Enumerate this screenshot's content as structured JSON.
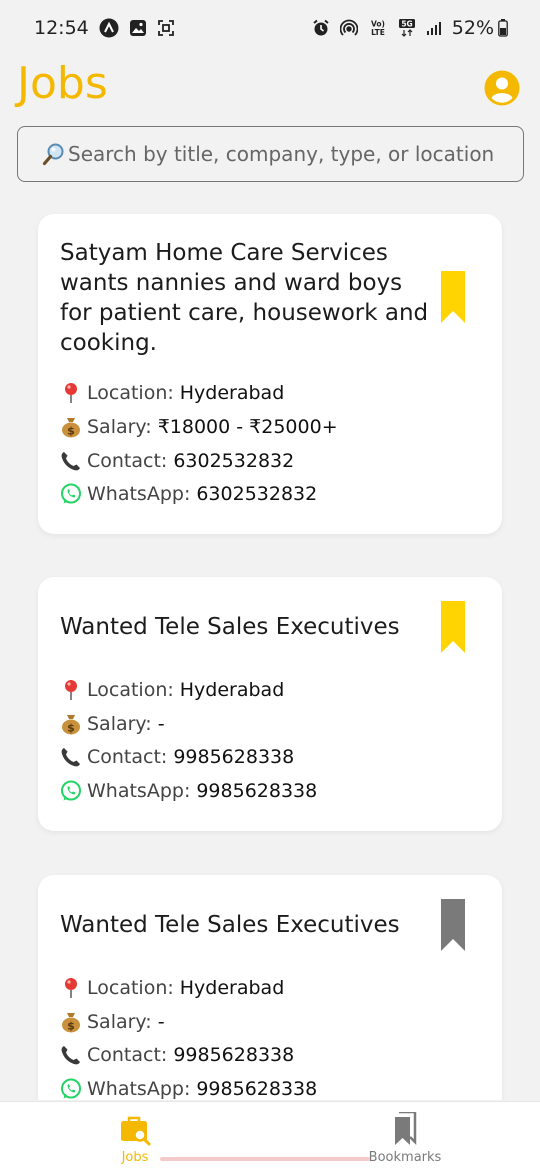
{
  "status_bar": {
    "time": "12:54",
    "battery": "52%",
    "icons": [
      "app-notification-icon",
      "image-icon",
      "screenshot-icon",
      "alarm-icon",
      "hotspot-icon",
      "volte-icon",
      "5g-icon",
      "signal-icon",
      "battery-icon"
    ]
  },
  "header": {
    "title": "Jobs",
    "account_icon": "account-circle-icon"
  },
  "search": {
    "placeholder": "Search by title, company, type, or location"
  },
  "labels": {
    "location": "Location:",
    "salary": "Salary:",
    "contact": "Contact:",
    "whatsapp": "WhatsApp:"
  },
  "jobs": [
    {
      "title": "Satyam Home Care Services wants nannies and ward boys for patient care, housework and cooking.",
      "location": "Hyderabad",
      "salary": "₹18000 - ₹25000+",
      "contact": "6302532832",
      "whatsapp": "6302532832",
      "bookmarked": true
    },
    {
      "title": "Wanted Tele Sales Executives",
      "location": "Hyderabad",
      "salary": "-",
      "contact": "9985628338",
      "whatsapp": "9985628338",
      "bookmarked": true
    },
    {
      "title": "Wanted Tele Sales Executives",
      "location": "Hyderabad",
      "salary": "-",
      "contact": "9985628338",
      "whatsapp": "9985628338",
      "bookmarked": false
    }
  ],
  "nav": {
    "jobs_label": "Jobs",
    "bookmarks_label": "Bookmarks",
    "active": "jobs"
  },
  "colors": {
    "accent": "#f5b800",
    "bookmark_active": "#ffd400",
    "bookmark_inactive": "#7a7a7a",
    "nav_active": "#f5b800",
    "nav_inactive": "#7a7a7a"
  }
}
